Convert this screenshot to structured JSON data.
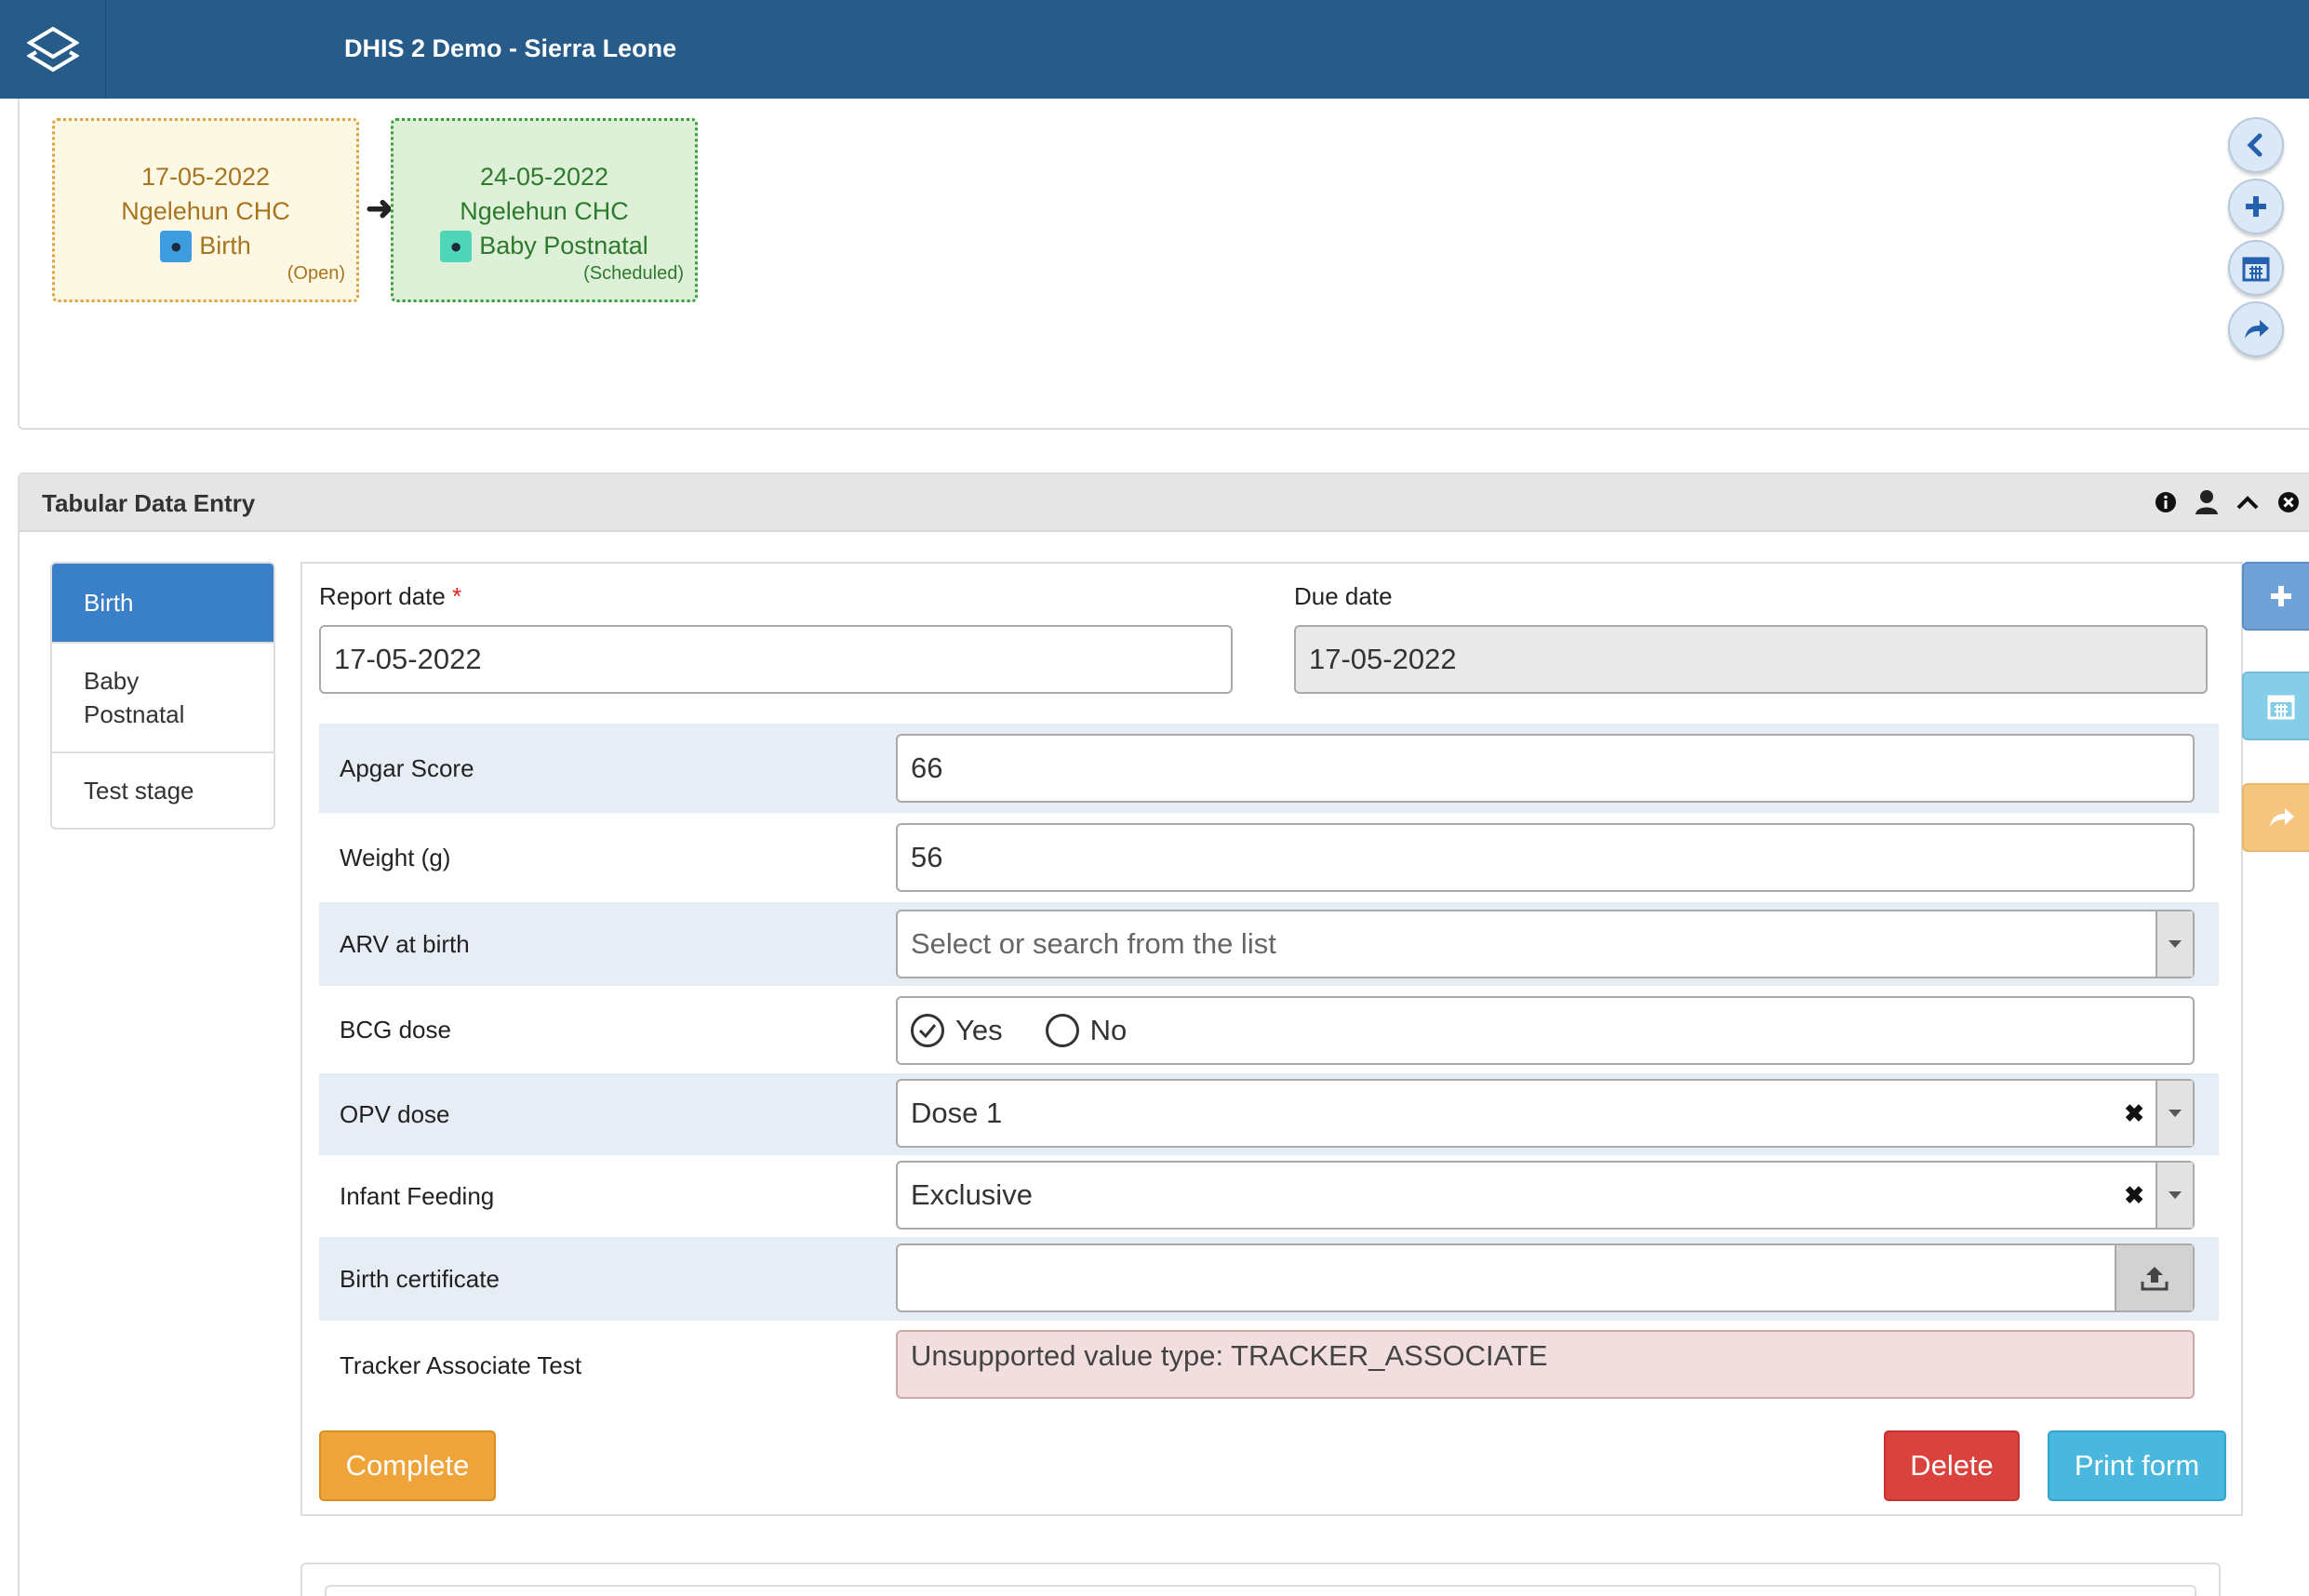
{
  "header": {
    "title": "DHIS 2 Demo - Sierra Leone"
  },
  "timeline": {
    "events": [
      {
        "date": "17-05-2022",
        "org_unit": "Ngelehun CHC",
        "stage": "Birth",
        "status": "(Open)"
      },
      {
        "date": "24-05-2022",
        "org_unit": "Ngelehun CHC",
        "stage": "Baby Postnatal",
        "status": "(Scheduled)"
      }
    ],
    "actions": [
      "chevron-left-icon",
      "plus-icon",
      "calendar-icon",
      "share-icon"
    ]
  },
  "tabular": {
    "title": "Tabular Data Entry",
    "header_icons": [
      "info-icon",
      "user-icon",
      "chevron-up-icon",
      "close-circle-icon"
    ],
    "stages": [
      {
        "label": "Birth",
        "active": true
      },
      {
        "label": "Baby Postnatal",
        "active": false
      },
      {
        "label": "Test stage",
        "active": false
      }
    ],
    "report_date_label": "Report date",
    "required_mark": "*",
    "report_date_value": "17-05-2022",
    "due_date_label": "Due date",
    "due_date_value": "17-05-2022",
    "rows": {
      "apgar": {
        "label": "Apgar Score",
        "value": "66"
      },
      "weight": {
        "label": "Weight (g)",
        "value": "56"
      },
      "arv": {
        "label": "ARV at birth",
        "placeholder": "Select or search from the list"
      },
      "bcg": {
        "label": "BCG dose",
        "yes": "Yes",
        "no": "No",
        "selected": "Yes"
      },
      "opv": {
        "label": "OPV dose",
        "value": "Dose 1"
      },
      "feeding": {
        "label": "Infant Feeding",
        "value": "Exclusive"
      },
      "certificate": {
        "label": "Birth certificate",
        "value": ""
      },
      "tracker": {
        "label": "Tracker Associate Test",
        "message": "Unsupported value type: TRACKER_ASSOCIATE"
      }
    },
    "buttons": {
      "complete": "Complete",
      "delete": "Delete",
      "print": "Print form"
    },
    "colors": {
      "complete": "#efa43a",
      "delete": "#d9423d",
      "print": "#4ab7df",
      "side_add": "#6fa3d8",
      "side_schedule": "#86cde8",
      "side_refer": "#f5c57e"
    }
  }
}
